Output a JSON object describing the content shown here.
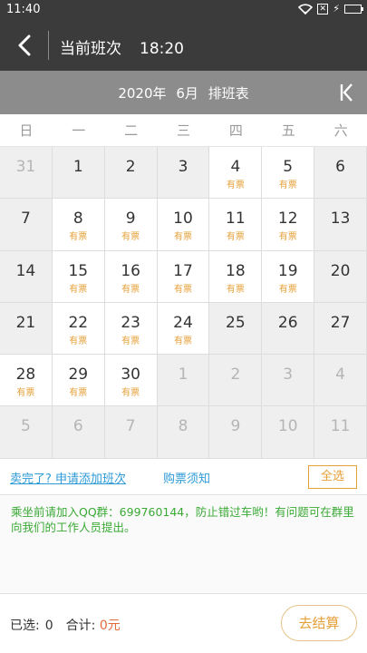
{
  "status_bar": {
    "time": "11:40",
    "sim_icon": "no-sim-icon",
    "wifi_icon": "wifi-icon",
    "battery_icon": "battery-charging-icon"
  },
  "header": {
    "title": "当前班次",
    "time": "18:20"
  },
  "month_bar": {
    "year": "2020年",
    "month": "6月",
    "label": "排班表"
  },
  "weekdays": [
    "日",
    "一",
    "二",
    "三",
    "四",
    "五",
    "六"
  ],
  "calendar": {
    "cells": [
      {
        "day": "31",
        "tag": "",
        "state": "muted"
      },
      {
        "day": "1",
        "tag": "",
        "state": "normal"
      },
      {
        "day": "2",
        "tag": "",
        "state": "normal"
      },
      {
        "day": "3",
        "tag": "",
        "state": "normal"
      },
      {
        "day": "4",
        "tag": "有票",
        "state": "avail"
      },
      {
        "day": "5",
        "tag": "有票",
        "state": "avail"
      },
      {
        "day": "6",
        "tag": "",
        "state": "normal"
      },
      {
        "day": "7",
        "tag": "",
        "state": "normal"
      },
      {
        "day": "8",
        "tag": "有票",
        "state": "avail"
      },
      {
        "day": "9",
        "tag": "有票",
        "state": "avail"
      },
      {
        "day": "10",
        "tag": "有票",
        "state": "avail"
      },
      {
        "day": "11",
        "tag": "有票",
        "state": "avail"
      },
      {
        "day": "12",
        "tag": "有票",
        "state": "avail"
      },
      {
        "day": "13",
        "tag": "",
        "state": "normal"
      },
      {
        "day": "14",
        "tag": "",
        "state": "normal"
      },
      {
        "day": "15",
        "tag": "有票",
        "state": "avail"
      },
      {
        "day": "16",
        "tag": "有票",
        "state": "avail"
      },
      {
        "day": "17",
        "tag": "有票",
        "state": "avail"
      },
      {
        "day": "18",
        "tag": "有票",
        "state": "avail"
      },
      {
        "day": "19",
        "tag": "有票",
        "state": "avail"
      },
      {
        "day": "20",
        "tag": "",
        "state": "normal"
      },
      {
        "day": "21",
        "tag": "",
        "state": "normal"
      },
      {
        "day": "22",
        "tag": "有票",
        "state": "avail"
      },
      {
        "day": "23",
        "tag": "有票",
        "state": "avail"
      },
      {
        "day": "24",
        "tag": "有票",
        "state": "avail"
      },
      {
        "day": "25",
        "tag": "",
        "state": "normal"
      },
      {
        "day": "26",
        "tag": "",
        "state": "normal"
      },
      {
        "day": "27",
        "tag": "",
        "state": "normal"
      },
      {
        "day": "28",
        "tag": "有票",
        "state": "avail"
      },
      {
        "day": "29",
        "tag": "有票",
        "state": "avail"
      },
      {
        "day": "30",
        "tag": "有票",
        "state": "avail"
      },
      {
        "day": "1",
        "tag": "",
        "state": "muted"
      },
      {
        "day": "2",
        "tag": "",
        "state": "muted"
      },
      {
        "day": "3",
        "tag": "",
        "state": "muted"
      },
      {
        "day": "4",
        "tag": "",
        "state": "muted"
      },
      {
        "day": "5",
        "tag": "",
        "state": "muted"
      },
      {
        "day": "6",
        "tag": "",
        "state": "muted"
      },
      {
        "day": "7",
        "tag": "",
        "state": "muted"
      },
      {
        "day": "8",
        "tag": "",
        "state": "muted"
      },
      {
        "day": "9",
        "tag": "",
        "state": "muted"
      },
      {
        "day": "10",
        "tag": "",
        "state": "muted"
      },
      {
        "day": "11",
        "tag": "",
        "state": "muted"
      }
    ]
  },
  "links": {
    "add_trip": "卖完了? 申请添加班次",
    "purchase_notes": "购票须知",
    "select_all": "全选"
  },
  "notice": "乘坐前请加入QQ群：699760144，防止错过车哟！有问题可在群里向我们的工作人员提出。",
  "footer": {
    "selected_label": "已选:",
    "selected_value": "0",
    "total_label": "合计:",
    "total_value": "0元",
    "checkout": "去结算"
  },
  "colors": {
    "header_bg": "#3b3b3b",
    "month_bg": "#8c8c8c",
    "accent": "#e6a039",
    "link": "#2d9ad7",
    "notice": "#3aaa35",
    "price": "#e06c3c"
  }
}
